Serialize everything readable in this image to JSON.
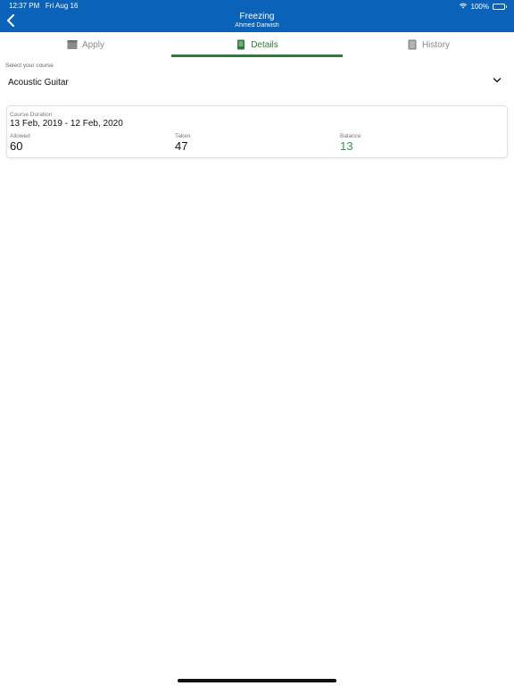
{
  "status_bar": {
    "time": "12:37 PM",
    "date": "Fri Aug 16",
    "battery": "100%"
  },
  "header": {
    "title": "Freezing",
    "subtitle": "Ahmed  Darwish"
  },
  "tabs": [
    {
      "label": "Apply",
      "icon": "calendar-icon"
    },
    {
      "label": "Details",
      "icon": "document-icon",
      "active": true
    },
    {
      "label": "History",
      "icon": "list-document-icon"
    }
  ],
  "course_select": {
    "label": "Select your course",
    "value": "Acoustic Guitar"
  },
  "details": {
    "duration_label": "Course Duration",
    "duration_value": "13 Feb, 2019 - 12 Feb, 2020",
    "allowed_label": "Allowed",
    "allowed_value": "60",
    "taken_label": "Taken",
    "taken_value": "47",
    "balance_label": "Balance",
    "balance_value": "13"
  },
  "colors": {
    "header": "#0a63b8",
    "accent": "#2f7a3c",
    "balance": "#2e9a48"
  }
}
